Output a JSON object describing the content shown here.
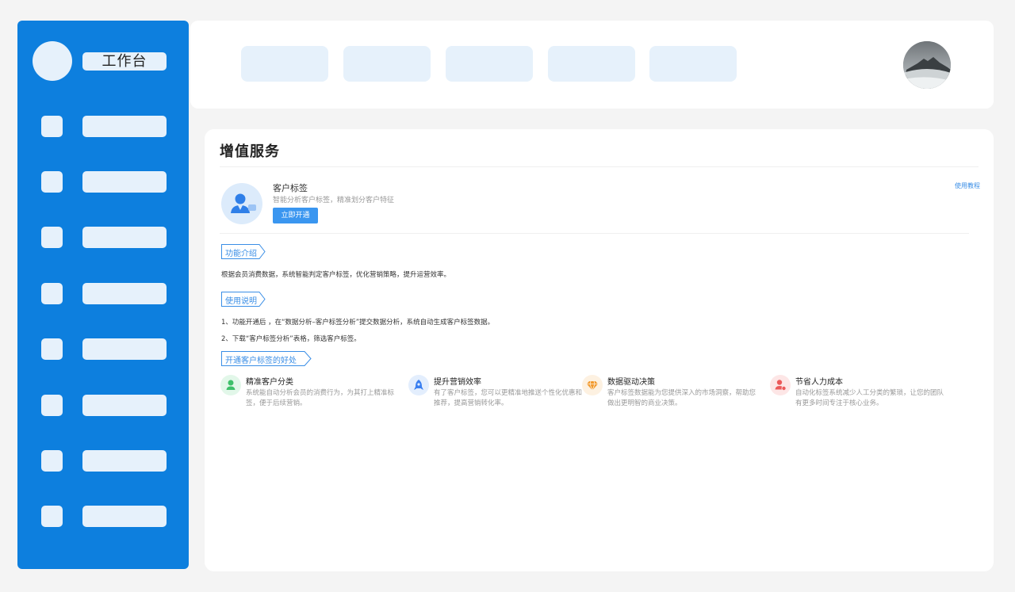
{
  "sidebar": {
    "title": "工作台",
    "item_count": 8
  },
  "header": {
    "tab_count": 5
  },
  "main": {
    "page_title": "增值服务",
    "service": {
      "name": "客户标签",
      "description": "智能分析客户标签，精准划分客户特征",
      "activate_label": "立即开通",
      "tutorial_label": "使用教程"
    },
    "sections": {
      "intro_label": "功能介绍",
      "intro_text": "根据会员消费数据，系统智能判定客户标签，优化营销策略，提升运营效率。",
      "usage_label": "使用说明",
      "usage_step1": "1、功能开通后 ，在“数据分析–客户标签分析”提交数据分析，系统自动生成客户标签数据。",
      "usage_step2": "2、下载“客户标签分析”表格，筛选客户标签。",
      "benefits_label": "开通客户标签的好处"
    },
    "benefits": [
      {
        "title": "精准客户分类",
        "description": "系统能自动分析会员的消费行为，为其打上精准标签，便于后续营销。",
        "icon": "user-icon",
        "color": "#3ec06a",
        "bg": "#e2f7e9"
      },
      {
        "title": "提升营销效率",
        "description": "有了客户标签，您可以更精准地推送个性化优惠和推荐，提高营销转化率。",
        "icon": "rocket-icon",
        "color": "#3a7ff0",
        "bg": "#e3eefd"
      },
      {
        "title": "数据驱动决策",
        "description": "客户标签数据能为您提供深入的市场洞察，帮助您做出更明智的商业决策。",
        "icon": "diamond-icon",
        "color": "#f29a2e",
        "bg": "#fdf1e1"
      },
      {
        "title": "节省人力成本",
        "description": "自动化标签系统减少人工分类的繁琐，让您的团队有更多时间专注于核心业务。",
        "icon": "person-cost-icon",
        "color": "#ec5a5a",
        "bg": "#fde6e6"
      }
    ]
  }
}
